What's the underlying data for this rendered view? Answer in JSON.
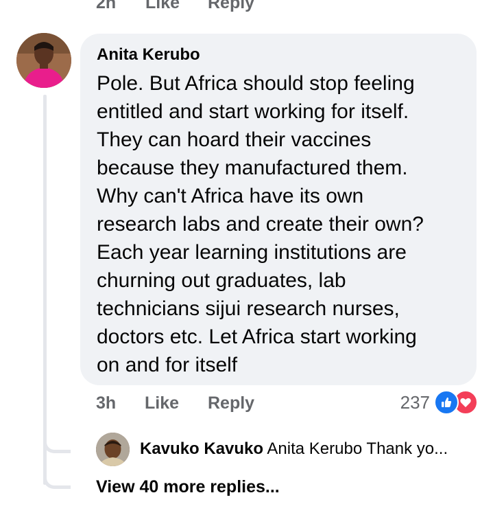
{
  "prev_comment_actions": {
    "time": "2h",
    "like": "Like",
    "reply": "Reply"
  },
  "comment": {
    "author": "Anita Kerubo",
    "text": "Pole. But Africa should stop feeling\nentitled and start working for itself.\nThey can hoard their vaccines\nbecause they manufactured them.\nWhy can't Africa have its own\nresearch labs and create their own?\nEach year learning institutions are\nchurning out graduates, lab\ntechnicians sijui research nurses,\ndoctors etc. Let Africa start working\non and for itself",
    "time": "3h",
    "like_label": "Like",
    "reply_label": "Reply",
    "reaction_count": "237",
    "reaction_icons": [
      "like-icon",
      "love-icon"
    ],
    "avatar_colors": {
      "bg": "#8b5a3c",
      "shirt": "#e91e8c"
    }
  },
  "reply_preview": {
    "author": "Kavuko Kavuko",
    "text": "Anita Kerubo Thank yo..."
  },
  "more_replies_label": "View 40 more replies...",
  "colors": {
    "bubble": "#f0f2f5",
    "secondary_text": "#65676b",
    "like_blue": "#1877f2",
    "love_red": "#f33e58",
    "thread_line": "#e4e6eb"
  }
}
